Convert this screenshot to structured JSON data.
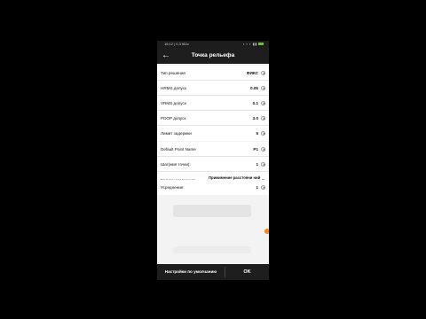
{
  "statusbar": {
    "time": "16:12 | 0,3 КБ/с",
    "icons": "▪ ▪ ▪ ▮▮"
  },
  "header": {
    "back_icon": "arrow-left-icon",
    "title": "Точка рельефа"
  },
  "section1": [
    {
      "label": "Тип решения",
      "value": "ФИКС"
    },
    {
      "label": "HRMS допуск",
      "value": "0.05"
    },
    {
      "label": "VRMS допуск",
      "value": "0.1"
    },
    {
      "label": "PDOP допуск",
      "value": "3.0"
    },
    {
      "label": "Лимит задержки",
      "value": "5"
    }
  ],
  "section2": [
    {
      "label": "Default Point Name",
      "value": "P1"
    },
    {
      "label": "Шаг(имя точки):",
      "value": "1"
    },
    {
      "label": "Код по умолчанию",
      "value": "Прижимение расстояни ний"
    }
  ],
  "section3": [
    {
      "label": "Усреднение:",
      "value": "1"
    }
  ],
  "footer": {
    "default_button": "Настройки по умолчанию",
    "ok_button": "OK"
  },
  "colors": {
    "bar": "#1e1e1e",
    "background": "#f3f3f3",
    "accent": "#f08a24",
    "battery": "#6dbf3a"
  }
}
